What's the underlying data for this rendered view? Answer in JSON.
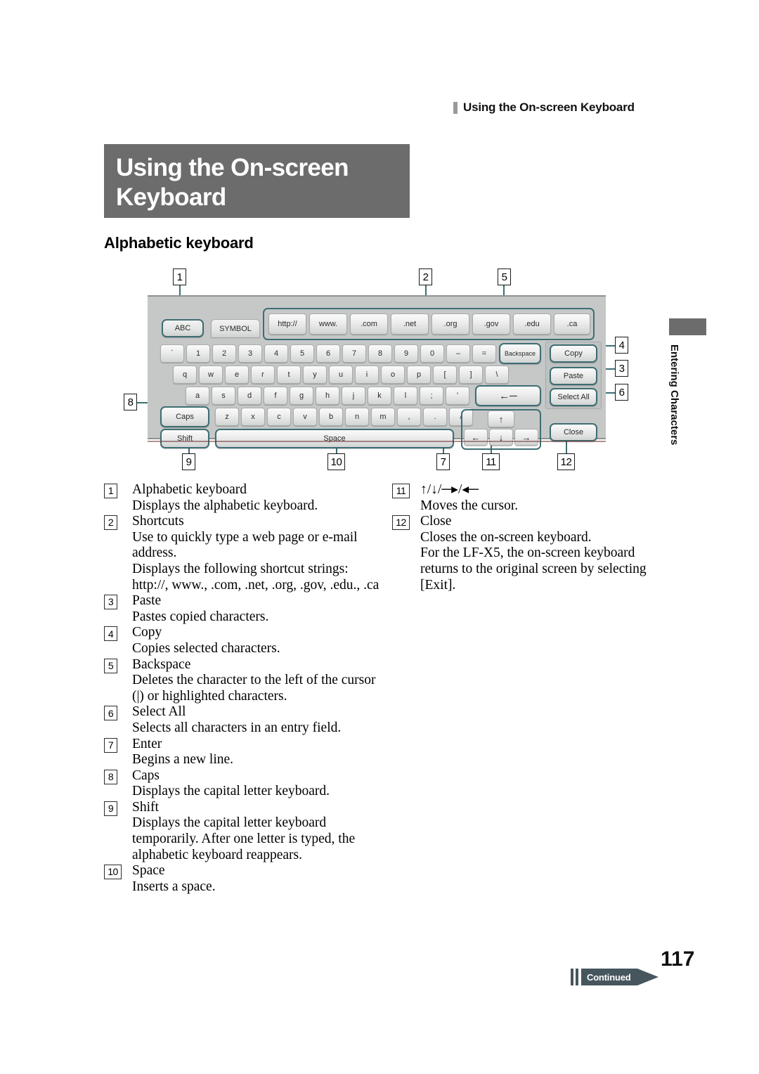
{
  "header": {
    "running_title": "Using the On-screen Keyboard"
  },
  "title_block": {
    "line1": "Using the On-screen",
    "line2": "Keyboard"
  },
  "section": {
    "heading": "Alphabetic keyboard"
  },
  "figure": {
    "callouts": [
      {
        "id": "1",
        "label": "1"
      },
      {
        "id": "2",
        "label": "2"
      },
      {
        "id": "5",
        "label": "5"
      },
      {
        "id": "4",
        "label": "4"
      },
      {
        "id": "3",
        "label": "3"
      },
      {
        "id": "6",
        "label": "6"
      },
      {
        "id": "8",
        "label": "8"
      },
      {
        "id": "9",
        "label": "9"
      },
      {
        "id": "10",
        "label": "10"
      },
      {
        "id": "7",
        "label": "7"
      },
      {
        "id": "11",
        "label": "11"
      },
      {
        "id": "12",
        "label": "12"
      }
    ],
    "tabs": [
      {
        "label": "ABC",
        "selected": true
      },
      {
        "label": "SYMBOL",
        "selected": false
      }
    ],
    "shortcuts": [
      "http://",
      "www.",
      ".com",
      ".net",
      ".org",
      ".gov",
      ".edu",
      ".ca"
    ],
    "row_numbers": [
      "`",
      "1",
      "2",
      "3",
      "4",
      "5",
      "6",
      "7",
      "8",
      "9",
      "0",
      "–",
      "="
    ],
    "row_q": [
      "q",
      "w",
      "e",
      "r",
      "t",
      "y",
      "u",
      "i",
      "o",
      "p",
      "[",
      "]",
      "\\"
    ],
    "row_a": [
      "a",
      "s",
      "d",
      "f",
      "g",
      "h",
      "j",
      "k",
      "l",
      ";",
      "'"
    ],
    "row_z": [
      "z",
      "x",
      "c",
      "v",
      "b",
      "n",
      "m",
      ",",
      ".",
      "/"
    ],
    "backspace_label": "Backspace",
    "enter_label": "←─",
    "caps_label": "Caps",
    "shift_label": "Shift",
    "space_label": "Space",
    "arrows": {
      "up": "↑",
      "left": "←",
      "down": "↓",
      "right": "→"
    },
    "side_buttons": [
      {
        "label": "Copy"
      },
      {
        "label": "Paste"
      },
      {
        "label": "Select All"
      },
      {
        "label": "Close"
      }
    ]
  },
  "descriptions_left": [
    {
      "num": "1",
      "term": "Alphabetic keyboard",
      "lines": [
        "Displays the alphabetic keyboard."
      ]
    },
    {
      "num": "2",
      "term": "Shortcuts",
      "lines": [
        "Use to quickly type a web page or e-mail",
        "address.",
        "Displays the following shortcut strings:",
        "http://, www., .com, .net, .org, .gov, .edu., .ca"
      ]
    },
    {
      "num": "3",
      "term": "Paste",
      "lines": [
        "Pastes copied characters."
      ]
    },
    {
      "num": "4",
      "term": "Copy",
      "lines": [
        "Copies selected characters."
      ]
    },
    {
      "num": "5",
      "term": "Backspace",
      "lines": [
        "Deletes the character to the left of the cursor",
        "(|) or highlighted characters."
      ]
    },
    {
      "num": "6",
      "term": "Select All",
      "lines": [
        "Selects all characters in an entry field."
      ]
    },
    {
      "num": "7",
      "term": "Enter",
      "lines": [
        "Begins a new line."
      ]
    },
    {
      "num": "8",
      "term": "Caps",
      "lines": [
        "Displays the capital letter keyboard."
      ]
    },
    {
      "num": "9",
      "term": "Shift",
      "lines": [
        "Displays the capital letter keyboard",
        "temporarily. After one letter is typed, the",
        "alphabetic keyboard reappears."
      ]
    },
    {
      "num": "10",
      "term": "Space",
      "lines": [
        "Inserts a space."
      ]
    }
  ],
  "descriptions_right": [
    {
      "num": "11",
      "term": "↑/↓/─▸/◂─",
      "lines": [
        "Moves the cursor."
      ]
    },
    {
      "num": "12",
      "term": "Close",
      "lines": [
        "Closes the on-screen keyboard.",
        "For the LF-X5, the on-screen keyboard",
        "returns to the original screen by selecting",
        "[Exit]."
      ]
    }
  ],
  "thumb_tab": {
    "label": "Entering Characters"
  },
  "footer": {
    "page_number": "117",
    "continued_label": "Continued"
  },
  "colors": {
    "title_block_bg": "#6c6c6c",
    "highlight": "#3d6e73",
    "keyboard_bg": "#c6c8c8",
    "footer_flag": "#46565c"
  }
}
